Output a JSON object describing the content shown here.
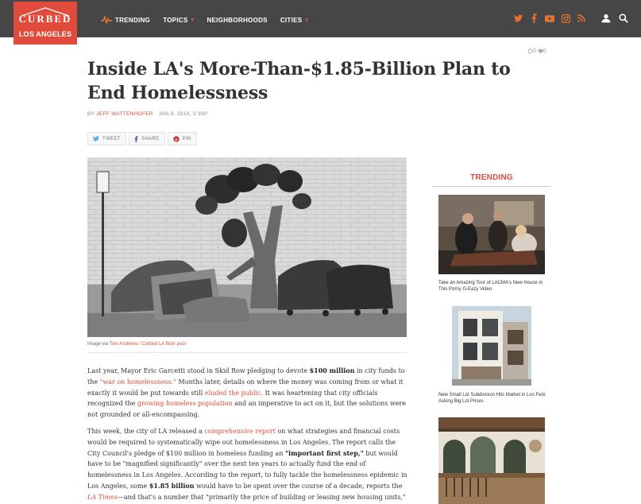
{
  "header": {
    "logo_word": "CURBED",
    "logo_city": "LOS ANGELES",
    "nav": [
      {
        "label": "TRENDING"
      },
      {
        "label": "TOPICS"
      },
      {
        "label": "NEIGHBORHOODS"
      },
      {
        "label": "CITIES"
      }
    ],
    "social_icons": [
      "twitter-icon",
      "facebook-icon",
      "youtube-icon",
      "instagram-icon",
      "rss-icon"
    ],
    "brand_color": "#e14b3b",
    "accent_color": "#e8732f"
  },
  "article": {
    "comment_count": "0",
    "like_count": "0",
    "title": "Inside LA's More-Than-$1.85-Billion Plan to End Homelessness",
    "by": "BY",
    "author": "JEFF WATTENHOFER",
    "date": "JAN 8, 2016, 3:30P",
    "share": {
      "tweet": "TWEET",
      "share": "SHARE",
      "pin": "PIN"
    },
    "caption_prefix": "Image via",
    "caption_link": "Tom Andrews / Curbed LA flickr pool",
    "p1": {
      "t1": "Last year, Mayor Eric Garcetti stood in Skid Row pledging to devote",
      "b1": "$100 million",
      "t2": "in city funds to the",
      "l1": "\"war on homelessness.\"",
      "t3": "Months later, details on where the money was coming from or what it exactly it would be put towards still",
      "l2": "eluded the public",
      "t4": ". It was heartening that city officials recognized the",
      "l3": "growing homeless population",
      "t5": "and an imperative to act on it, but the solutions were not grounded or all-encompassing."
    },
    "p2": {
      "t1": "This week, the city of LA released a",
      "l1": "comprehensive report",
      "t2": "on what strategies and financial costs would be required to systematically wipe out homelessness in Los Angeles. The report calls the City Council's pledge of $100 million in homeless funding an",
      "b1": "\"important first step,\"",
      "t3": "but would have to be \"magnified significantly\" over the next ten years to actually fund the end of homelessness in Los Angeles. According to the report, to fully tackle the homelessness epidemic in Los Angeles, some",
      "b2": "$1.85 billion",
      "t4": "would have to be spent over the course of a decade, reports the",
      "l2": "LA Times",
      "t5": "—and that's a number that \"primarily the price of building or leasing new housing units,\" but not the expanded"
    }
  },
  "sidebar": {
    "title": "TRENDING",
    "cards": [
      {
        "caption": "Take an Amazing Tour of LACMA's New House in This Porny G-Eazy Video"
      },
      {
        "caption": "New Small Lot Subdivision Hits Market in Los Feliz Asking Big Lot Prices"
      },
      {
        "caption": ""
      }
    ]
  }
}
